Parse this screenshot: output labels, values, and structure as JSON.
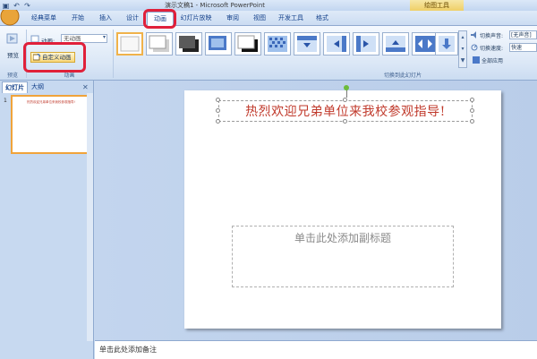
{
  "window": {
    "title": "演示文稿1 - Microsoft PowerPoint",
    "context_tab": "绘图工具"
  },
  "quick_access": {
    "icons": [
      "save-icon",
      "undo-icon",
      "redo-icon"
    ]
  },
  "tabs": [
    {
      "label": "经典菜单",
      "active": false
    },
    {
      "label": "开始",
      "active": false
    },
    {
      "label": "插入",
      "active": false
    },
    {
      "label": "设计",
      "active": false
    },
    {
      "label": "动画",
      "active": true
    },
    {
      "label": "幻灯片放映",
      "active": false
    },
    {
      "label": "审阅",
      "active": false
    },
    {
      "label": "视图",
      "active": false
    },
    {
      "label": "开发工具",
      "active": false
    },
    {
      "label": "格式",
      "active": false
    }
  ],
  "ribbon": {
    "preview": {
      "button": "预览",
      "group": "预览"
    },
    "animation": {
      "animate_label": "动画:",
      "animate_value": "无动画",
      "custom_animation": "自定义动画",
      "group": "动画"
    },
    "transition": {
      "sound_label": "切换声音:",
      "sound_value": "[无声音]",
      "speed_label": "切换速度:",
      "speed_value": "快速",
      "apply_all": "全部应用",
      "group": "切换到此幻灯片"
    }
  },
  "left_pane": {
    "tabs": [
      "幻灯片",
      "大纲"
    ],
    "slide_number": "1",
    "thumb_text": "热烈欢迎兄弟单位来我校参观指导!"
  },
  "slide": {
    "title": "热烈欢迎兄弟单位来我校参观指导!",
    "subtitle_placeholder": "单击此处添加副标题"
  },
  "notes": {
    "placeholder": "单击此处添加备注"
  },
  "colors": {
    "title_red": "#c0392b",
    "highlight": "#e0203a",
    "ribbon_blue": "#dbe7f6"
  }
}
